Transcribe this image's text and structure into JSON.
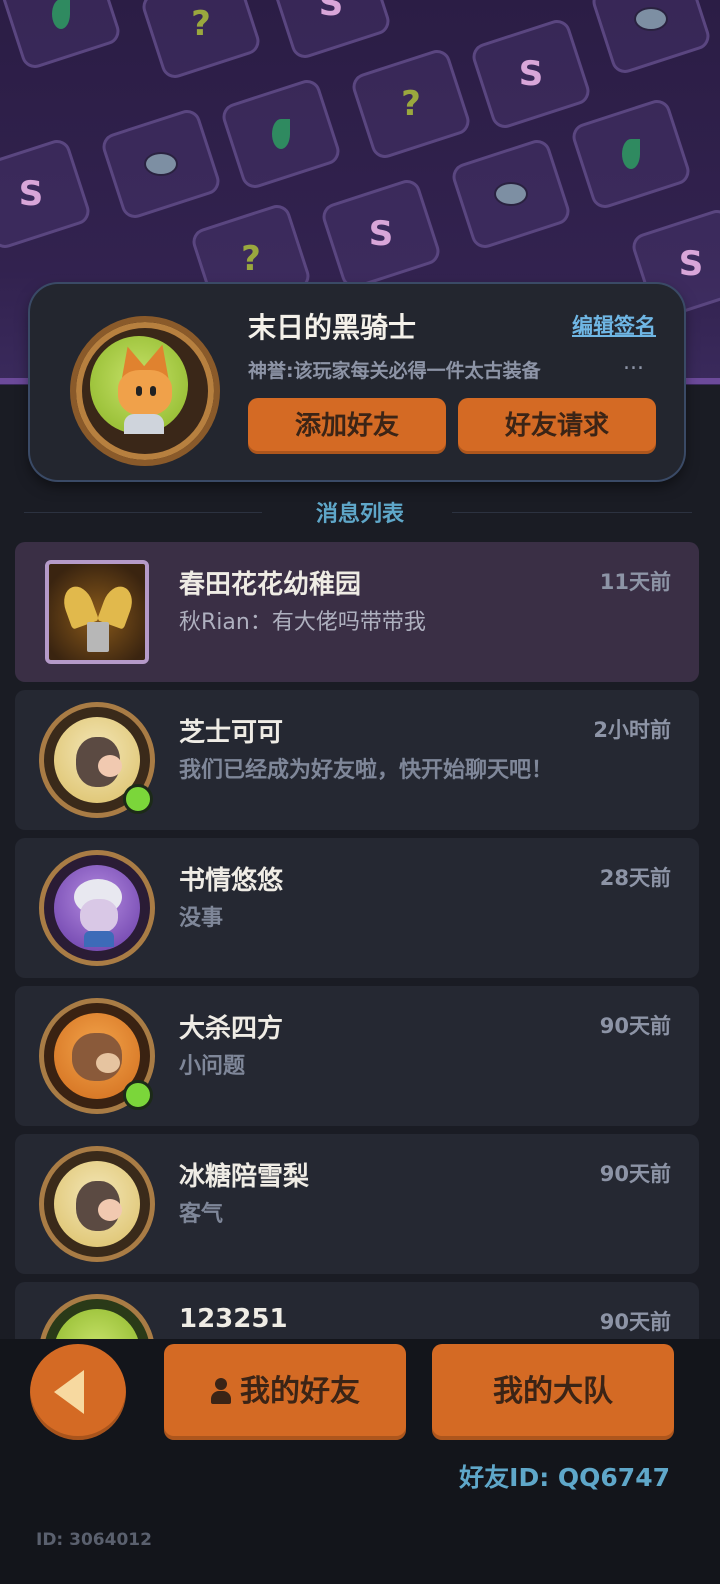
{
  "profile": {
    "name": "末日的黑骑士",
    "edit_sign_label": "编辑签名",
    "title": "神誉:该玩家每关必得一件太古装备",
    "title_ellipsis": "...",
    "add_friend_label": "添加好友",
    "friend_requests_label": "好友请求"
  },
  "section_title": "消息列表",
  "messages": [
    {
      "name": "春田花花幼稚园",
      "preview": "秋Rian：有大佬吗带带我",
      "time": "11天前"
    },
    {
      "name": "芝士可可",
      "preview": "我们已经成为好友啦，快开始聊天吧！",
      "time": "2小时前"
    },
    {
      "name": "书情悠悠",
      "preview": "没事",
      "time": "28天前"
    },
    {
      "name": "大杀四方",
      "preview": "小问题",
      "time": "90天前"
    },
    {
      "name": "冰糖陪雪梨",
      "preview": "客气",
      "time": "90天前"
    },
    {
      "name": "123251",
      "preview": "",
      "time": "90天前"
    }
  ],
  "bottom": {
    "my_friends_label": "我的好友",
    "my_team_label": "我的大队",
    "friend_id": "好友ID: QQ6747",
    "user_id": "ID: 3064012"
  }
}
